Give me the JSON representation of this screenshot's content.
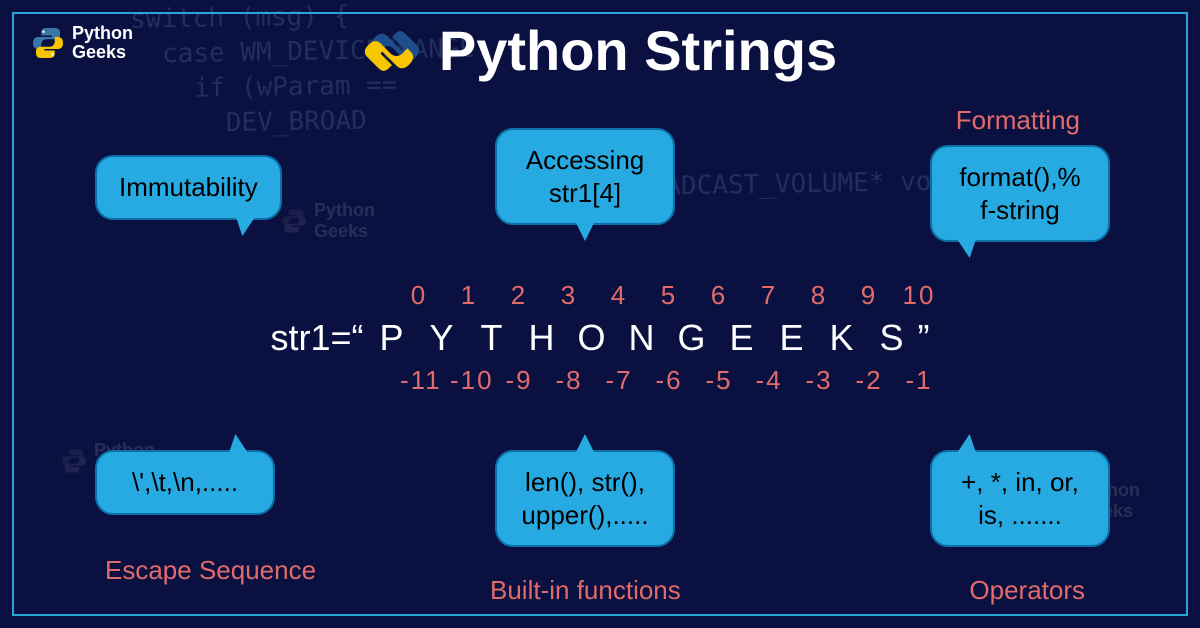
{
  "brand": {
    "name_line1": "Python",
    "name_line2": "Geeks"
  },
  "title": "Python Strings",
  "bubbles": {
    "immutability": "Immutability",
    "accessing_l1": "Accessing",
    "accessing_l2": "str1[4]",
    "format_l1": "format(),%",
    "format_l2": "f-string",
    "escape": "\\',\\t,\\n,.....",
    "builtin_l1": "len(), str(),",
    "builtin_l2": "upper(),.....",
    "operators_l1": "+, *, in, or,",
    "operators_l2": "is, ......."
  },
  "labels": {
    "formatting": "Formatting",
    "escape": "Escape Sequence",
    "builtin": "Built-in functions",
    "operators": "Operators"
  },
  "string_demo": {
    "prefix": "str1=“",
    "chars": [
      "P",
      "Y",
      "T",
      "H",
      "O",
      "N",
      "G",
      "E",
      "E",
      "K",
      "S"
    ],
    "suffix": "”",
    "pos_idx": [
      "0",
      "1",
      "2",
      "3",
      "4",
      "5",
      "6",
      "7",
      "8",
      "9",
      "10"
    ],
    "neg_idx": [
      "-11",
      "-10",
      "-9",
      "-8",
      "-7",
      "-6",
      "-5",
      "-4",
      "-3",
      "-2",
      "-1"
    ]
  },
  "bg_code": "LRESULT CALLBACK\n  switch (msg) {\n    case WM_DEVICECHANGE: {\n      if (wParam ==\n        DEV_BROAD\n                           if (info-\n                             DEV_BROADCAST_VOLUME* volumeInfo\n"
}
